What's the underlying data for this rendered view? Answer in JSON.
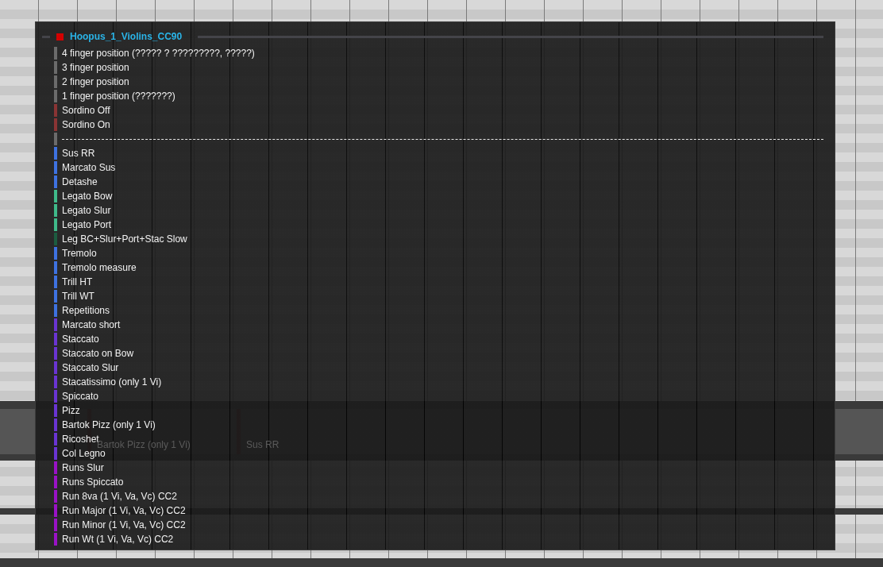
{
  "menu": {
    "title": "Hoopus_1_Violins_CC90",
    "items": [
      {
        "kind": "item",
        "label": "4 finger position (????? ? ?????????, ?????)",
        "color": "#6b6b6b"
      },
      {
        "kind": "item",
        "label": "3 finger position",
        "color": "#6b6b6b"
      },
      {
        "kind": "item",
        "label": "2 finger position",
        "color": "#6b6b6b"
      },
      {
        "kind": "item",
        "label": "1 finger position (???????)",
        "color": "#6b6b6b"
      },
      {
        "kind": "item",
        "label": "Sordino Off",
        "color": "#8a3434"
      },
      {
        "kind": "item",
        "label": "Sordino On",
        "color": "#8a3434"
      },
      {
        "kind": "separator",
        "color": "#6b6b6b"
      },
      {
        "kind": "item",
        "label": "Sus RR",
        "color": "#3e72e0"
      },
      {
        "kind": "item",
        "label": "Marcato Sus",
        "color": "#3e72e0"
      },
      {
        "kind": "item",
        "label": "Detashe",
        "color": "#3e72e0"
      },
      {
        "kind": "item",
        "label": "Legato Bow",
        "color": "#3fba8a"
      },
      {
        "kind": "item",
        "label": "Legato Slur",
        "color": "#3fba8a"
      },
      {
        "kind": "item",
        "label": "Legato Port",
        "color": "#3fba8a"
      },
      {
        "kind": "item",
        "label": "Leg BC+Slur+Port+Stac Slow",
        "color": "#1c5c40"
      },
      {
        "kind": "item",
        "label": "Tremolo",
        "color": "#3e72e0"
      },
      {
        "kind": "item",
        "label": "Tremolo measure",
        "color": "#3e72e0"
      },
      {
        "kind": "item",
        "label": "Trill HT",
        "color": "#3e72e0"
      },
      {
        "kind": "item",
        "label": "Trill WT",
        "color": "#3e72e0"
      },
      {
        "kind": "item",
        "label": "Repetitions",
        "color": "#3e72e0"
      },
      {
        "kind": "item",
        "label": "Marcato short",
        "color": "#6a34d2"
      },
      {
        "kind": "item",
        "label": "Staccato",
        "color": "#6a34d2"
      },
      {
        "kind": "item",
        "label": "Staccato on Bow",
        "color": "#6a34d2"
      },
      {
        "kind": "item",
        "label": "Staccato Slur",
        "color": "#6a34d2"
      },
      {
        "kind": "item",
        "label": "Stacatissimo (only 1 Vi)",
        "color": "#6a34d2"
      },
      {
        "kind": "item",
        "label": "Spiccato",
        "color": "#6a34d2"
      },
      {
        "kind": "item",
        "label": "Pizz",
        "color": "#6a34d2"
      },
      {
        "kind": "item",
        "label": "Bartok Pizz (only 1 Vi)",
        "color": "#6a34d2"
      },
      {
        "kind": "item",
        "label": "Ricoshet",
        "color": "#6a34d2"
      },
      {
        "kind": "item",
        "label": "Col Legno",
        "color": "#6a34d2"
      },
      {
        "kind": "item",
        "label": "Runs Slur",
        "color": "#9a12c6"
      },
      {
        "kind": "item",
        "label": "Runs Spiccato",
        "color": "#9a12c6"
      },
      {
        "kind": "item",
        "label": "Run 8va (1 Vi, Va, Vc) CC2",
        "color": "#9a12c6"
      },
      {
        "kind": "item",
        "label": "Run Major (1 Vi, Va, Vc) CC2",
        "color": "#9a12c6"
      },
      {
        "kind": "item",
        "label": "Run Minor (1 Vi, Va, Vc) CC2",
        "color": "#9a12c6"
      },
      {
        "kind": "item",
        "label": "Run Wt (1 Vi, Va, Vc) CC2",
        "color": "#9a12c6"
      }
    ]
  },
  "lane_events": [
    {
      "label": "Bartok Pizz (only 1 Vi)"
    },
    {
      "label": "Sus RR"
    }
  ]
}
